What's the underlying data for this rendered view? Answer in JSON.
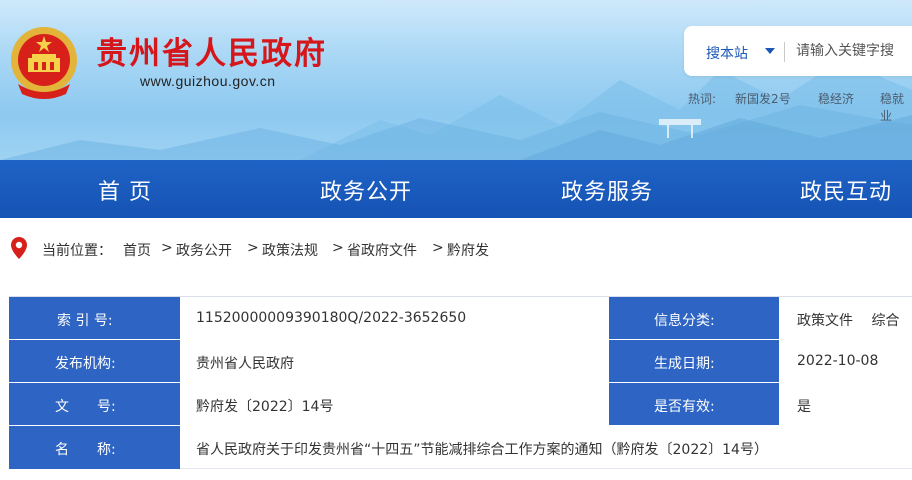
{
  "header": {
    "site_title": "贵州省人民政府",
    "site_url": "www.guizhou.gov.cn",
    "search": {
      "scope": "搜本站",
      "placeholder": "请输入关键字搜"
    },
    "hot": {
      "label": "热词:",
      "items": [
        "新国发2号",
        "稳经济",
        "稳就业"
      ]
    }
  },
  "nav": {
    "items": [
      "首 页",
      "政务公开",
      "政务服务",
      "政民互动"
    ]
  },
  "breadcrumb": {
    "prefix": "当前位置：",
    "items": [
      "首页",
      "政务公开",
      "政策法规",
      "省政府文件",
      "黔府发"
    ],
    "separator": ">"
  },
  "info": {
    "index_label": "索 引 号:",
    "index_value": "11520000009390180Q/2022-3652650",
    "category_label": "信息分类:",
    "category_value": "政策文件　 综合",
    "issuer_label": "发布机构:",
    "issuer_value": "贵州省人民政府",
    "date_label": "生成日期:",
    "date_value": "2022-10-08",
    "docno_label": "文　　号:",
    "docno_value": "黔府发〔2022〕14号",
    "valid_label": "是否有效:",
    "valid_value": "是",
    "name_label": "名　　称:",
    "name_value": "省人民政府关于印发贵州省“十四五”节能减排综合工作方案的通知（黔府发〔2022〕14号）"
  },
  "colors": {
    "title_red": "#d5161b",
    "nav_blue": "#1a5bbf",
    "label_blue": "#2e64c3"
  }
}
